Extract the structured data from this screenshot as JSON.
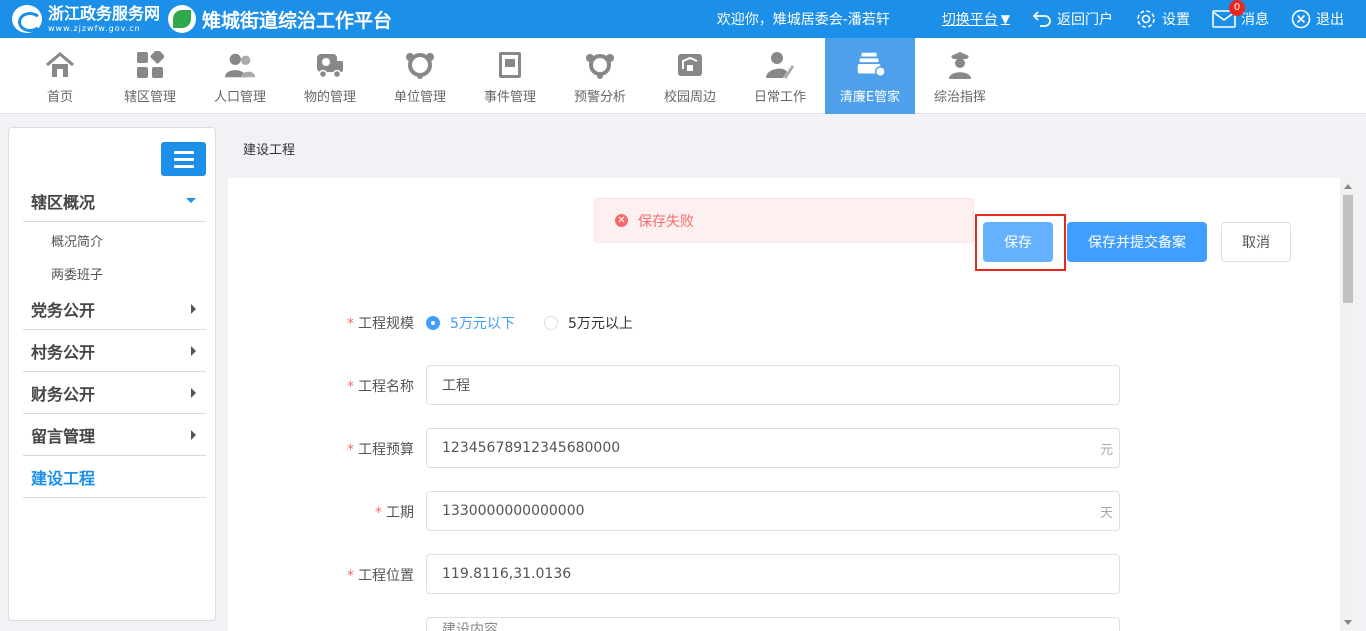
{
  "header": {
    "portal_name": "浙江政务服务网",
    "portal_domain": "www.zjzwfw.gov.cn",
    "platform_title": "雉城街道综治工作平台",
    "welcome": "欢迎你，雉城居委会-潘若轩",
    "switch_label": "切换平台",
    "return_label": "返回门户",
    "settings_label": "设置",
    "messages_label": "消息",
    "message_count": "0",
    "logout_label": "退出"
  },
  "nav": {
    "items": [
      {
        "label": "首页",
        "icon": "home-icon"
      },
      {
        "label": "辖区管理",
        "icon": "grid-icon"
      },
      {
        "label": "人口管理",
        "icon": "people-icon"
      },
      {
        "label": "物的管理",
        "icon": "vehicle-icon"
      },
      {
        "label": "单位管理",
        "icon": "network-icon"
      },
      {
        "label": "事件管理",
        "icon": "book-icon"
      },
      {
        "label": "预警分析",
        "icon": "alert-network-icon"
      },
      {
        "label": "校园周边",
        "icon": "school-icon"
      },
      {
        "label": "日常工作",
        "icon": "user-edit-icon"
      },
      {
        "label": "清廉E管家",
        "icon": "integrity-icon"
      },
      {
        "label": "综治指挥",
        "icon": "officer-icon"
      }
    ],
    "active_index": 9
  },
  "sidebar": {
    "sections": [
      {
        "label": "辖区概况",
        "expanded": true,
        "children": [
          "概况简介",
          "两委班子"
        ]
      },
      {
        "label": "党务公开"
      },
      {
        "label": "村务公开"
      },
      {
        "label": "财务公开"
      },
      {
        "label": "留言管理"
      },
      {
        "label": "建设工程",
        "active": true
      }
    ]
  },
  "breadcrumb": "建设工程",
  "alert": {
    "message": "保存失败"
  },
  "buttons": {
    "save": "保存",
    "save_submit": "保存并提交备案",
    "cancel": "取消"
  },
  "form": {
    "scale": {
      "label": "工程规模",
      "options": [
        "5万元以下",
        "5万元以上"
      ],
      "selected": 0
    },
    "name": {
      "label": "工程名称",
      "value": "工程"
    },
    "budget": {
      "label": "工程预算",
      "value": "12345678912345680000",
      "suffix": "元"
    },
    "duration": {
      "label": "工期",
      "value": "1330000000000000",
      "suffix": "天"
    },
    "location": {
      "label": "工程位置",
      "value": "119.8116,31.0136"
    },
    "next_field_value": "建设内容"
  },
  "colors": {
    "primary": "#1c8fe8",
    "button": "#409eff",
    "error": "#f56c6c",
    "highlight": "#e8281f"
  }
}
